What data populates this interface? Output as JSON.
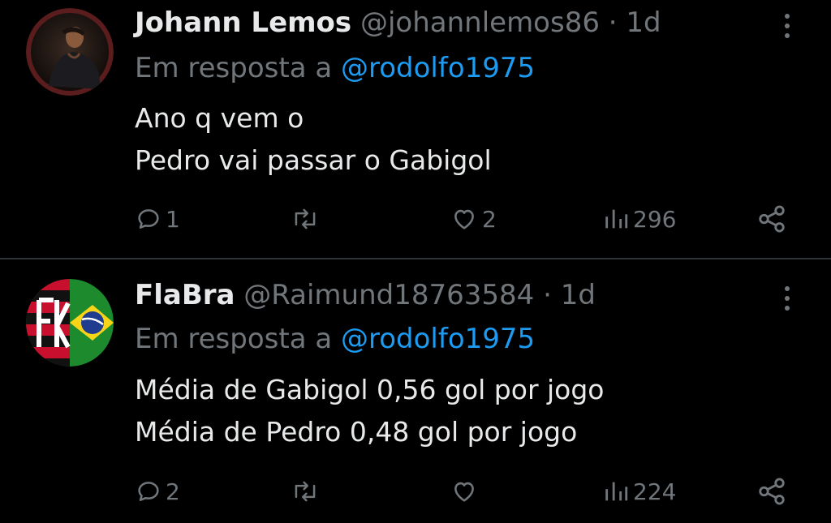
{
  "tweets": [
    {
      "name": "Johann Lemos",
      "handle": "@johannlemos86",
      "separator": "·",
      "time": "1d",
      "reply_prefix": "Em resposta a",
      "reply_mention": "@rodolfo1975",
      "text_lines": [
        "Ano q vem o",
        "Pedro vai passar o Gabigol"
      ],
      "stats": {
        "replies": "1",
        "retweets": "",
        "likes": "2",
        "views": "296"
      },
      "avatar_icon": "profile-photo"
    },
    {
      "name": "FlaBra",
      "handle": "@Raimund18763584",
      "separator": "·",
      "time": "1d",
      "reply_prefix": "Em resposta a",
      "reply_mention": "@rodolfo1975",
      "text_lines": [
        "Média de Gabigol 0,56 gol por jogo",
        "Média de Pedro 0,48 gol por jogo"
      ],
      "stats": {
        "replies": "2",
        "retweets": "",
        "likes": "",
        "views": "224"
      },
      "avatar_icon": "flamengo-brazil-flag-avatar"
    }
  ],
  "colors": {
    "background": "#000000",
    "primary_text": "#e7e9ea",
    "secondary_text": "#71767b",
    "link": "#1d9bf0",
    "divider": "#2f3336"
  }
}
